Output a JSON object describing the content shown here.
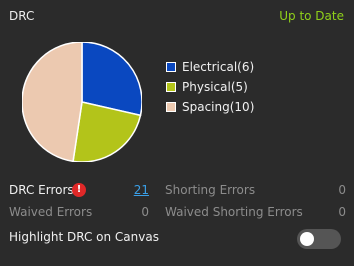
{
  "header": {
    "title": "DRC",
    "status": "Up to Date",
    "status_color": "#8fd11a"
  },
  "chart_data": {
    "type": "pie",
    "slices": [
      {
        "label": "Electrical(6)",
        "value": 6,
        "color": "#0a48c0"
      },
      {
        "label": "Physical(5)",
        "value": 5,
        "color": "#b3c41a"
      },
      {
        "label": "Spacing(10)",
        "value": 10,
        "color": "#ecc9b0"
      }
    ]
  },
  "stats": {
    "drc_errors_label": "DRC Errors",
    "drc_errors_value": "21",
    "drc_errors_icon": "error-icon",
    "shorting_errors_label": "Shorting Errors",
    "shorting_errors_value": "0",
    "waived_errors_label": "Waived Errors",
    "waived_errors_value": "0",
    "waived_shorting_errors_label": "Waived Shorting Errors",
    "waived_shorting_errors_value": "0"
  },
  "highlight": {
    "label": "Highlight DRC on Canvas",
    "enabled": false
  }
}
